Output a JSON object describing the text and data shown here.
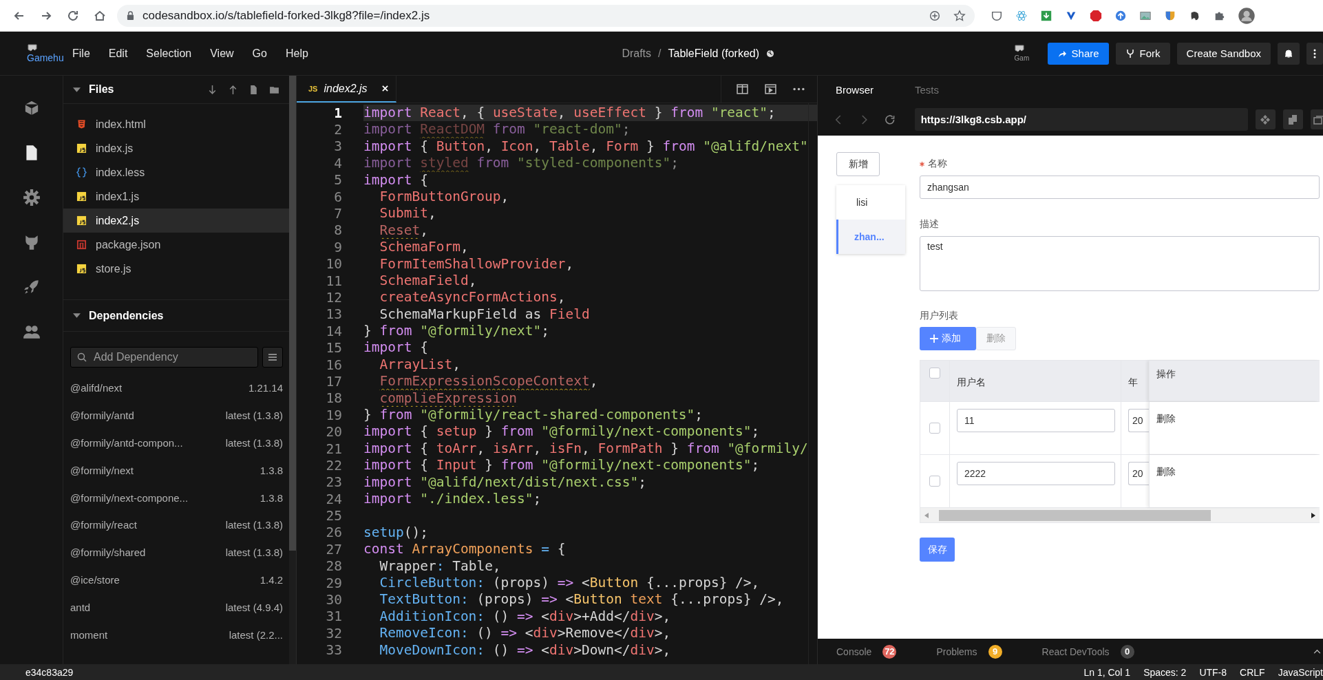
{
  "browser": {
    "url": "codesandbox.io/s/tablefield-forked-3lkg8?file=/index2.js"
  },
  "header": {
    "logo_alt": "Gamehu",
    "menu": [
      "File",
      "Edit",
      "Selection",
      "View",
      "Go",
      "Help"
    ],
    "breadcrumb": {
      "folder": "Drafts",
      "separator": "/",
      "title": "TableField (forked)"
    },
    "avatar_alt": "Gam",
    "buttons": [
      {
        "label": "Share",
        "kind": "share"
      },
      {
        "label": "Fork",
        "kind": "fork"
      },
      {
        "label": "Create Sandbox",
        "kind": "plain"
      }
    ]
  },
  "activity_bar": [
    {
      "kind": "cube",
      "selected": false
    },
    {
      "kind": "file",
      "selected": true
    },
    {
      "kind": "gear",
      "selected": false
    },
    {
      "kind": "github",
      "selected": false
    },
    {
      "kind": "rocket",
      "selected": false
    },
    {
      "kind": "people",
      "selected": false
    }
  ],
  "files": {
    "title": "Files",
    "items": [
      {
        "name": "index.html",
        "kind": "html",
        "selected": false
      },
      {
        "name": "index.js",
        "kind": "js",
        "selected": false
      },
      {
        "name": "index.less",
        "kind": "less",
        "selected": false
      },
      {
        "name": "index1.js",
        "kind": "js",
        "selected": false
      },
      {
        "name": "index2.js",
        "kind": "js",
        "selected": true
      },
      {
        "name": "package.json",
        "kind": "json",
        "selected": false
      },
      {
        "name": "store.js",
        "kind": "js",
        "selected": false
      }
    ]
  },
  "dependencies": {
    "title": "Dependencies",
    "search": {
      "placeholder": "Add Dependency"
    },
    "items": [
      {
        "name": "@alifd/next",
        "version": "1.21.14"
      },
      {
        "name": "@formily/antd",
        "version": "latest (1.3.8)"
      },
      {
        "name": "@formily/antd-compon...",
        "version": "latest (1.3.8)"
      },
      {
        "name": "@formily/next",
        "version": "1.3.8"
      },
      {
        "name": "@formily/next-compone...",
        "version": "1.3.8"
      },
      {
        "name": "@formily/react",
        "version": "latest (1.3.8)"
      },
      {
        "name": "@formily/shared",
        "version": "latest (1.3.8)"
      },
      {
        "name": "@ice/store",
        "version": "1.4.2"
      },
      {
        "name": "antd",
        "version": "latest (4.9.4)"
      },
      {
        "name": "moment",
        "version": "latest (2.2..."
      }
    ]
  },
  "editor": {
    "tab": {
      "badge": "JS",
      "name": "index2.js"
    },
    "lines": [
      {
        "number": "1",
        "current": true,
        "faded": false,
        "tokens": [
          {
            "text": "import",
            "kind": "kw"
          },
          {
            "text": " React",
            "kind": "id"
          },
          {
            "text": ", { ",
            "kind": "p"
          },
          {
            "text": "useState",
            "kind": "id"
          },
          {
            "text": ", ",
            "kind": "p"
          },
          {
            "text": "useEffect",
            "kind": "id"
          },
          {
            "text": " } ",
            "kind": "p"
          },
          {
            "text": "from ",
            "kind": "kw"
          },
          {
            "text": "\"react\"",
            "kind": "str"
          },
          {
            "text": ";",
            "kind": "p"
          }
        ]
      },
      {
        "number": "2",
        "current": false,
        "faded": true,
        "tokens": [
          {
            "text": "import ",
            "kind": "kw"
          },
          {
            "text": "ReactDOM",
            "kind": "unused"
          },
          {
            "text": " from ",
            "kind": "kw"
          },
          {
            "text": "\"react-dom\"",
            "kind": "str"
          },
          {
            "text": ";",
            "kind": "p"
          }
        ]
      },
      {
        "number": "3",
        "current": false,
        "faded": false,
        "tokens": [
          {
            "text": "import",
            "kind": "kw"
          },
          {
            "text": " { ",
            "kind": "p"
          },
          {
            "text": "Button",
            "kind": "id"
          },
          {
            "text": ", ",
            "kind": "p"
          },
          {
            "text": "Icon",
            "kind": "id"
          },
          {
            "text": ", ",
            "kind": "p"
          },
          {
            "text": "Table",
            "kind": "id"
          },
          {
            "text": ", ",
            "kind": "p"
          },
          {
            "text": "Form",
            "kind": "id"
          },
          {
            "text": " } ",
            "kind": "p"
          },
          {
            "text": "from ",
            "kind": "kw"
          },
          {
            "text": "\"@alifd/next\"",
            "kind": "str"
          }
        ]
      },
      {
        "number": "4",
        "current": false,
        "faded": true,
        "tokens": [
          {
            "text": "import ",
            "kind": "kw"
          },
          {
            "text": "styled",
            "kind": "unused"
          },
          {
            "text": " from ",
            "kind": "kw"
          },
          {
            "text": "\"styled-components\"",
            "kind": "str"
          },
          {
            "text": ";",
            "kind": "p"
          }
        ]
      },
      {
        "number": "5",
        "current": false,
        "faded": false,
        "tokens": [
          {
            "text": "import",
            "kind": "kw"
          },
          {
            "text": " {",
            "kind": "p"
          }
        ]
      },
      {
        "number": "6",
        "current": false,
        "faded": false,
        "tokens": [
          {
            "text": "  FormButtonGroup",
            "kind": "id"
          },
          {
            "text": ",",
            "kind": "p"
          }
        ]
      },
      {
        "number": "7",
        "current": false,
        "faded": false,
        "tokens": [
          {
            "text": "  Submit",
            "kind": "id"
          },
          {
            "text": ",",
            "kind": "p"
          }
        ]
      },
      {
        "number": "8",
        "current": false,
        "faded": false,
        "tokens": [
          {
            "text": "  Reset",
            "kind": "unused"
          },
          {
            "text": ",",
            "kind": "p"
          }
        ]
      },
      {
        "number": "9",
        "current": false,
        "faded": false,
        "tokens": [
          {
            "text": "  SchemaForm",
            "kind": "id"
          },
          {
            "text": ",",
            "kind": "p"
          }
        ]
      },
      {
        "number": "10",
        "current": false,
        "faded": false,
        "tokens": [
          {
            "text": "  FormItemShallowProvider",
            "kind": "id"
          },
          {
            "text": ",",
            "kind": "p"
          }
        ]
      },
      {
        "number": "11",
        "current": false,
        "faded": false,
        "tokens": [
          {
            "text": "  SchemaField",
            "kind": "id"
          },
          {
            "text": ",",
            "kind": "p"
          }
        ]
      },
      {
        "number": "12",
        "current": false,
        "faded": false,
        "tokens": [
          {
            "text": "  createAsyncFormActions",
            "kind": "id"
          },
          {
            "text": ",",
            "kind": "p"
          }
        ]
      },
      {
        "number": "13",
        "current": false,
        "faded": false,
        "tokens": [
          {
            "text": "  SchemaMarkupField as ",
            "kind": "p"
          },
          {
            "text": "Field",
            "kind": "id"
          }
        ]
      },
      {
        "number": "14",
        "current": false,
        "faded": false,
        "tokens": [
          {
            "text": "} ",
            "kind": "p"
          },
          {
            "text": "from ",
            "kind": "kw"
          },
          {
            "text": "\"@formily/next\"",
            "kind": "str"
          },
          {
            "text": ";",
            "kind": "p"
          }
        ]
      },
      {
        "number": "15",
        "current": false,
        "faded": false,
        "tokens": [
          {
            "text": "import",
            "kind": "kw"
          },
          {
            "text": " {",
            "kind": "p"
          }
        ]
      },
      {
        "number": "16",
        "current": false,
        "faded": false,
        "tokens": [
          {
            "text": "  ArrayList",
            "kind": "id"
          },
          {
            "text": ",",
            "kind": "p"
          }
        ]
      },
      {
        "number": "17",
        "current": false,
        "faded": false,
        "tokens": [
          {
            "text": "  FormExpressionScopeContext",
            "kind": "unused"
          },
          {
            "text": ",",
            "kind": "p"
          }
        ]
      },
      {
        "number": "18",
        "current": false,
        "faded": false,
        "tokens": [
          {
            "text": "  complieExpression",
            "kind": "unused"
          }
        ]
      },
      {
        "number": "19",
        "current": false,
        "faded": false,
        "tokens": [
          {
            "text": "} ",
            "kind": "p"
          },
          {
            "text": "from ",
            "kind": "kw"
          },
          {
            "text": "\"@formily/react-shared-components\"",
            "kind": "str"
          },
          {
            "text": ";",
            "kind": "p"
          }
        ]
      },
      {
        "number": "20",
        "current": false,
        "faded": false,
        "tokens": [
          {
            "text": "import",
            "kind": "kw"
          },
          {
            "text": " { ",
            "kind": "p"
          },
          {
            "text": "setup",
            "kind": "id"
          },
          {
            "text": " } ",
            "kind": "p"
          },
          {
            "text": "from ",
            "kind": "kw"
          },
          {
            "text": "\"@formily/next-components\"",
            "kind": "str"
          },
          {
            "text": ";",
            "kind": "p"
          }
        ]
      },
      {
        "number": "21",
        "current": false,
        "faded": false,
        "tokens": [
          {
            "text": "import",
            "kind": "kw"
          },
          {
            "text": " { ",
            "kind": "p"
          },
          {
            "text": "toArr",
            "kind": "id"
          },
          {
            "text": ", ",
            "kind": "p"
          },
          {
            "text": "isArr",
            "kind": "id"
          },
          {
            "text": ", ",
            "kind": "p"
          },
          {
            "text": "isFn",
            "kind": "id"
          },
          {
            "text": ", ",
            "kind": "p"
          },
          {
            "text": "FormPath",
            "kind": "id"
          },
          {
            "text": " } ",
            "kind": "p"
          },
          {
            "text": "from ",
            "kind": "kw"
          },
          {
            "text": "\"@formily/",
            "kind": "str"
          }
        ]
      },
      {
        "number": "22",
        "current": false,
        "faded": false,
        "tokens": [
          {
            "text": "import",
            "kind": "kw"
          },
          {
            "text": " { ",
            "kind": "p"
          },
          {
            "text": "Input",
            "kind": "id"
          },
          {
            "text": " } ",
            "kind": "p"
          },
          {
            "text": "from ",
            "kind": "kw"
          },
          {
            "text": "\"@formily/next-components\"",
            "kind": "str"
          },
          {
            "text": ";",
            "kind": "p"
          }
        ]
      },
      {
        "number": "23",
        "current": false,
        "faded": false,
        "tokens": [
          {
            "text": "import ",
            "kind": "kw"
          },
          {
            "text": "\"@alifd/next/dist/next.css\"",
            "kind": "str"
          },
          {
            "text": ";",
            "kind": "p"
          }
        ]
      },
      {
        "number": "24",
        "current": false,
        "faded": false,
        "tokens": [
          {
            "text": "import ",
            "kind": "kw"
          },
          {
            "text": "\"./index.less\"",
            "kind": "str"
          },
          {
            "text": ";",
            "kind": "p"
          }
        ]
      },
      {
        "number": "25",
        "current": false,
        "faded": false
      },
      {
        "number": "26",
        "current": false,
        "faded": false,
        "tokens": [
          {
            "text": "setup",
            "kind": "fn"
          },
          {
            "text": "();",
            "kind": "p"
          }
        ]
      },
      {
        "number": "27",
        "current": false,
        "faded": false,
        "tokens": [
          {
            "text": "const ",
            "kind": "kw"
          },
          {
            "text": "ArrayComponents",
            "kind": "cls"
          },
          {
            "text": " = ",
            "kind": "fn"
          },
          {
            "text": "{",
            "kind": "p"
          }
        ]
      },
      {
        "number": "28",
        "current": false,
        "faded": false,
        "tokens": [
          {
            "text": "  Wrapper",
            "kind": "p"
          },
          {
            "text": ":",
            "kind": "fn"
          },
          {
            "text": " Table,",
            "kind": "p"
          }
        ]
      },
      {
        "number": "29",
        "current": false,
        "faded": false,
        "tokens": [
          {
            "text": "  CircleButton:",
            "kind": "fn"
          },
          {
            "text": " (props) ",
            "kind": "p"
          },
          {
            "text": "=>",
            "kind": "kw"
          },
          {
            "text": " <",
            "kind": "p"
          },
          {
            "text": "Button",
            "kind": "tag"
          },
          {
            "text": " {...props} />,",
            "kind": "p"
          }
        ]
      },
      {
        "number": "30",
        "current": false,
        "faded": false,
        "tokens": [
          {
            "text": "  TextButton:",
            "kind": "fn"
          },
          {
            "text": " (props) ",
            "kind": "p"
          },
          {
            "text": "=>",
            "kind": "kw"
          },
          {
            "text": " <",
            "kind": "p"
          },
          {
            "text": "Button",
            "kind": "tag"
          },
          {
            "text": " text",
            "kind": "cls"
          },
          {
            "text": " {...props} />,",
            "kind": "p"
          }
        ]
      },
      {
        "number": "31",
        "current": false,
        "faded": false,
        "tokens": [
          {
            "text": "  AdditionIcon:",
            "kind": "fn"
          },
          {
            "text": " () ",
            "kind": "p"
          },
          {
            "text": "=>",
            "kind": "kw"
          },
          {
            "text": " <",
            "kind": "p"
          },
          {
            "text": "div",
            "kind": "id"
          },
          {
            "text": ">+Add</",
            "kind": "p"
          },
          {
            "text": "div",
            "kind": "id"
          },
          {
            "text": ">,",
            "kind": "p"
          }
        ]
      },
      {
        "number": "32",
        "current": false,
        "faded": false,
        "tokens": [
          {
            "text": "  RemoveIcon:",
            "kind": "fn"
          },
          {
            "text": " () ",
            "kind": "p"
          },
          {
            "text": "=>",
            "kind": "kw"
          },
          {
            "text": " <",
            "kind": "p"
          },
          {
            "text": "div",
            "kind": "id"
          },
          {
            "text": ">Remove</",
            "kind": "p"
          },
          {
            "text": "div",
            "kind": "id"
          },
          {
            "text": ">,",
            "kind": "p"
          }
        ]
      },
      {
        "number": "33",
        "current": false,
        "faded": false,
        "tokens": [
          {
            "text": "  MoveDownIcon:",
            "kind": "fn"
          },
          {
            "text": " () ",
            "kind": "p"
          },
          {
            "text": "=>",
            "kind": "kw"
          },
          {
            "text": " <",
            "kind": "p"
          },
          {
            "text": "div",
            "kind": "id"
          },
          {
            "text": ">Down</",
            "kind": "p"
          },
          {
            "text": "div",
            "kind": "id"
          },
          {
            "text": ">,",
            "kind": "p"
          }
        ]
      }
    ]
  },
  "preview": {
    "tabs": [
      {
        "label": "Browser",
        "selected": true
      },
      {
        "label": "Tests",
        "selected": false
      }
    ],
    "url": "https://3lkg8.csb.app/",
    "page": {
      "add_button": "新增",
      "records": [
        {
          "label": "lisi",
          "selected": false
        },
        {
          "label": "zhan...",
          "selected": true
        }
      ],
      "fields": [
        {
          "label": "名称",
          "required": true,
          "value": "zhangsan",
          "kind": "input"
        },
        {
          "label": "描述",
          "required": false,
          "value": "test",
          "kind": "textarea"
        }
      ],
      "list_title": "用户列表",
      "actions": [
        {
          "label": "添加",
          "kind": "primary",
          "disabled": false
        },
        {
          "label": "删除",
          "kind": "normal",
          "disabled": true
        }
      ],
      "table": {
        "header_checked": false,
        "columns": [
          "用户名",
          "年"
        ],
        "action_column": "操作",
        "rows": [
          {
            "checked": false,
            "name": "11",
            "age": "20",
            "action": "删除"
          },
          {
            "checked": false,
            "name": "2222",
            "age": "20",
            "action": "删除"
          }
        ]
      },
      "save_button": "保存"
    },
    "devtools": [
      {
        "label": "Console",
        "count": "72",
        "color": "#e0675f"
      },
      {
        "label": "Problems",
        "count": "9",
        "color": "#f2ae28"
      },
      {
        "label": "React DevTools",
        "count": "0",
        "color": "#474747"
      }
    ]
  },
  "status_bar": {
    "commit": "e34c83a29",
    "items": [
      "Ln 1, Col 1",
      "Spaces: 2",
      "UTF-8",
      "CRLF",
      "JavaScript"
    ]
  }
}
